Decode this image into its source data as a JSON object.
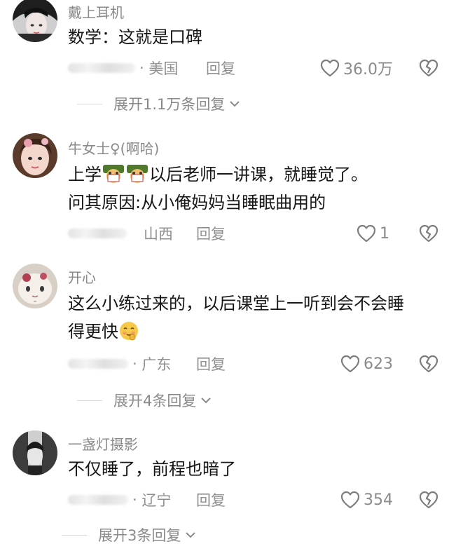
{
  "comments": [
    {
      "username": "戴上耳机",
      "text": [
        "数学：这就是口碑"
      ],
      "region": "美国",
      "reply_label": "回复",
      "likes": "36.0万",
      "expand_label": "展开1.1万条回复"
    },
    {
      "username": "牛女士♀(啊哈)",
      "text_prefix": "上学",
      "text_suffix": "以后老师一讲课，就睡觉了。",
      "text_line2": "问其原因:从小俺妈妈当睡眠曲用的",
      "region": "山西",
      "reply_label": "回复",
      "likes": "1"
    },
    {
      "username": "开心",
      "text_line1": "这么小练过来的，以后课堂上一听到会不会睡",
      "text_line2": "得更快",
      "region": "广东",
      "reply_label": "回复",
      "likes": "623",
      "expand_label": "展开4条回复"
    },
    {
      "username": "一盏灯摄影",
      "text": [
        "不仅睡了，前程也暗了"
      ],
      "region": "辽宁",
      "reply_label": "回复",
      "likes": "354",
      "expand_label": "展开3条回复"
    }
  ],
  "icons": {
    "like": "heart-outline-icon",
    "dislike": "broken-heart-icon",
    "expand": "chevron-down-icon"
  },
  "colors": {
    "text": "#161616",
    "meta": "#8f8f8f",
    "icon": "#8a8a8a"
  }
}
